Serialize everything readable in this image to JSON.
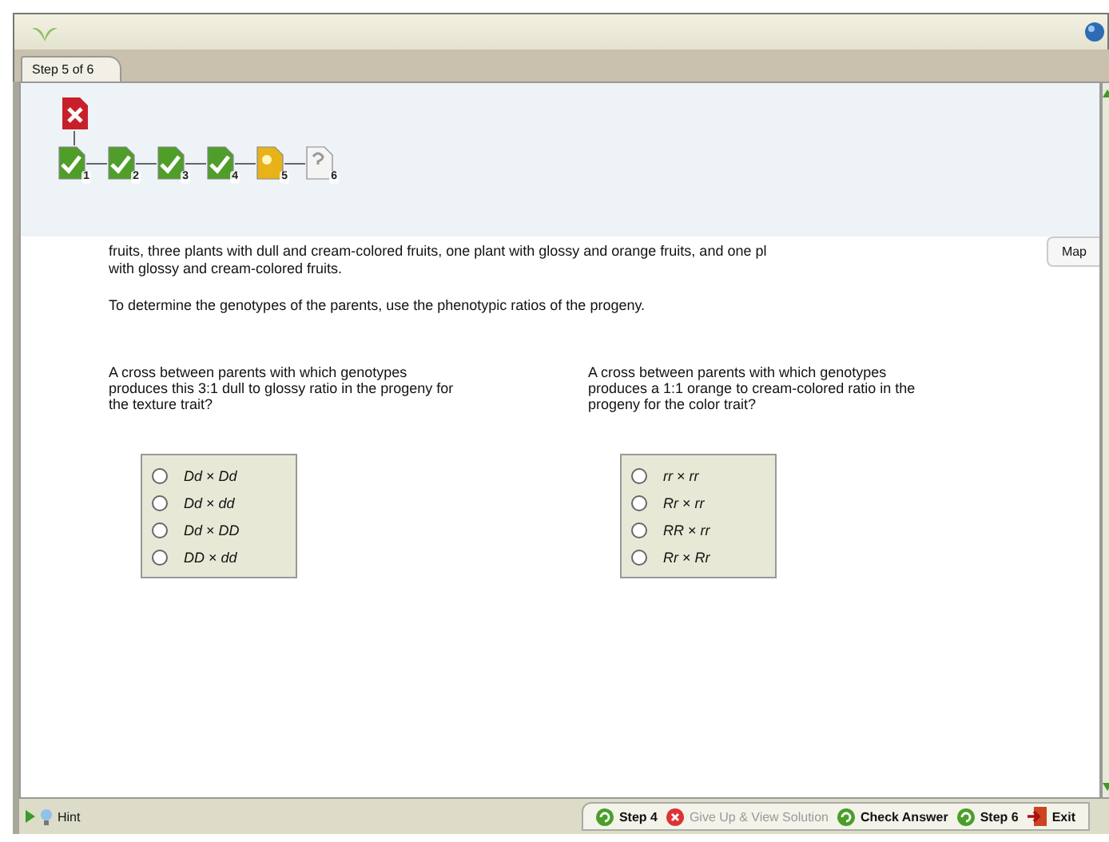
{
  "tab": {
    "label": "Step 5 of 6",
    "selected": true
  },
  "step_map": [
    {
      "kind": "error"
    },
    {
      "kind": "done",
      "label": "1"
    },
    {
      "kind": "done",
      "label": "2"
    },
    {
      "kind": "done",
      "label": "3"
    },
    {
      "kind": "done",
      "label": "4"
    },
    {
      "kind": "current",
      "label": "5"
    },
    {
      "kind": "pending",
      "label": "6"
    }
  ],
  "map_tab": {
    "label": "Map"
  },
  "intro": [
    "fruits, three plants with dull and cream-colored fruits, one plant with glossy and orange fruits, and one pl",
    "with glossy and cream-colored fruits."
  ],
  "instruction": "To determine the genotypes of the parents, use the phenotypic ratios of the progeny.",
  "questions": [
    {
      "prompt": "A cross between parents with which genotypes produces this 3:1 dull to glossy ratio in the progeny for the texture trait?",
      "options": [
        {
          "label": "*Dd* × *Dd*",
          "selected": false
        },
        {
          "label": "*Dd* × *dd*",
          "selected": false
        },
        {
          "label": "*Dd* × *DD*",
          "selected": false
        },
        {
          "label": "*DD* × *dd*",
          "selected": false
        }
      ]
    },
    {
      "prompt": "A cross between parents with which genotypes produces a 1:1 orange to cream-colored ratio in the progeny for the color trait?",
      "options": [
        {
          "label": "*rr* × *rr*",
          "selected": false
        },
        {
          "label": "*Rr* × *rr*",
          "selected": false
        },
        {
          "label": "*RR* × *rr*",
          "selected": false
        },
        {
          "label": "*Rr* × *Rr*",
          "selected": false
        }
      ]
    }
  ],
  "hint": "Hint",
  "actions": [
    {
      "kind": "back",
      "label": "Step 4",
      "disabled": false
    },
    {
      "kind": "giveup",
      "label": "Give Up & View Solution",
      "disabled": true
    },
    {
      "kind": "check",
      "label": "Check Answer",
      "disabled": false
    },
    {
      "kind": "next",
      "label": "Step 6",
      "disabled": false
    },
    {
      "kind": "exit",
      "label": "Exit",
      "disabled": false
    }
  ]
}
